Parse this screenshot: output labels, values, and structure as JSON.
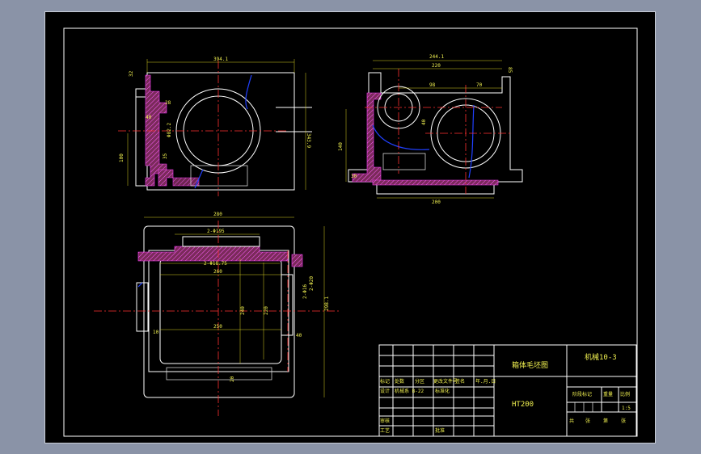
{
  "title_block": {
    "drawing_title": "箱体毛坯图",
    "drawing_number": "机械10-3",
    "material": "HT200",
    "labels": {
      "mark": "标记",
      "count": "处数",
      "zone": "分区",
      "change_doc": "更改文件号",
      "signature": "签名",
      "date": "年.月.日",
      "designer": "设计",
      "standardization": "标准化",
      "check": "审核",
      "process": "工艺",
      "approve": "批准",
      "stage_mark": "阶段标记",
      "weight": "重量",
      "scale": "比例",
      "sheet_total": "共",
      "sheet_num": "张",
      "sheet_of": "第"
    },
    "designer_value": "机械系 B-22",
    "scale_value": "1:5"
  },
  "dimensions": {
    "front_width": "394.1",
    "front_height": "343.9",
    "front_left_height": "100",
    "front_small_1": "40",
    "front_small_2": "28",
    "front_bore": "Φ82.2",
    "front_small_3": "35",
    "front_top_left": "32",
    "side_total_width": "244.1",
    "side_inner_width": "220",
    "side_upper": "98",
    "side_70": "70",
    "side_40": "40",
    "side_height": "140",
    "side_bottom": "200",
    "side_left_small": "30",
    "side_right_small": "85",
    "top_width": "280",
    "top_bore_span": "2-Φ195",
    "top_hole": "2-Φ18.75",
    "top_inner": "260",
    "top_inner2": "250",
    "top_height": "298.1",
    "top_inner_h": "240",
    "top_inner_h2": "220",
    "top_10": "10",
    "top_20": "20",
    "top_40": "40",
    "top_right_small": "2-Φ16",
    "top_right_small2": "2-Φ20"
  }
}
